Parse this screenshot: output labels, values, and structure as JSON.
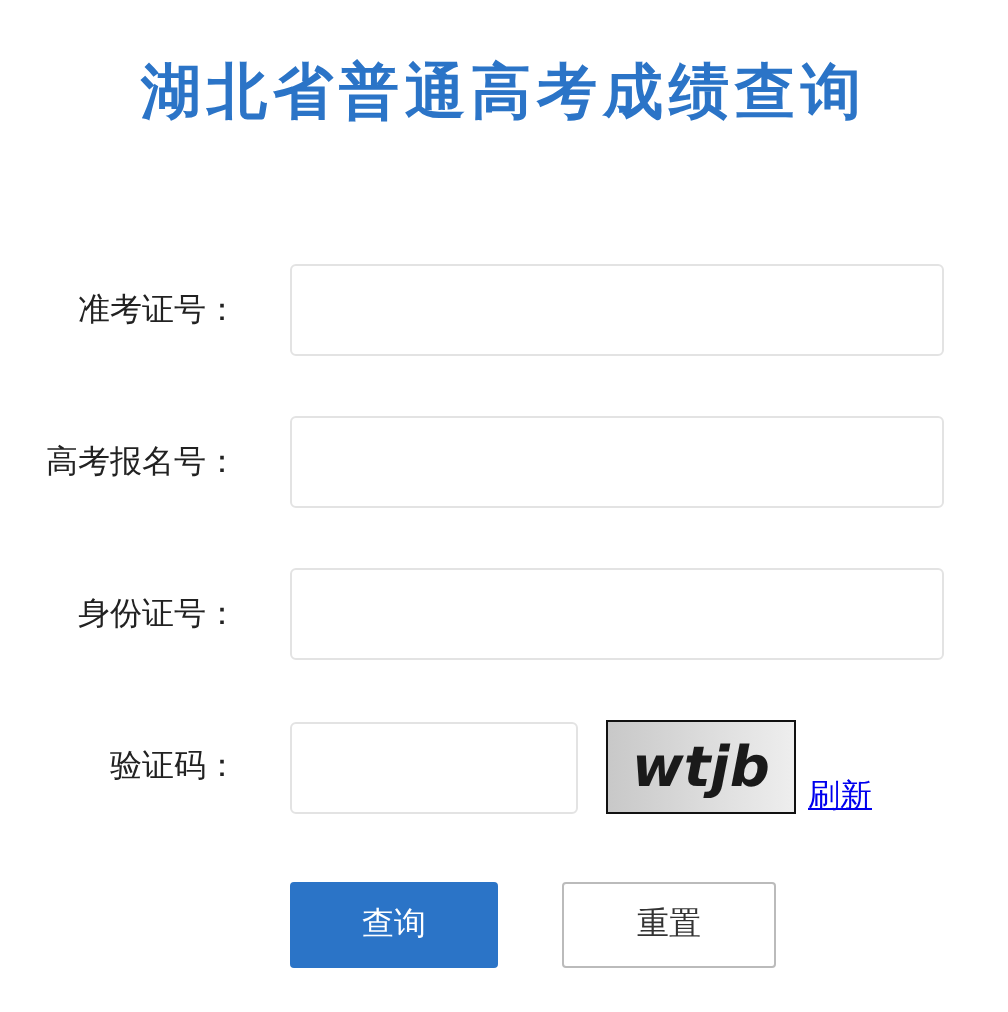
{
  "title": "湖北省普通高考成绩查询",
  "fields": [
    {
      "label": "准考证号：",
      "kind": "text"
    },
    {
      "label": "高考报名号：",
      "kind": "text"
    },
    {
      "label": "身份证号：",
      "kind": "text"
    },
    {
      "label": "验证码：",
      "kind": "captcha"
    }
  ],
  "captcha": {
    "text": "wtjb",
    "refresh": "刷新"
  },
  "buttons": [
    {
      "label": "查询",
      "kind": "primary"
    },
    {
      "label": "重置",
      "kind": "secondary"
    }
  ]
}
